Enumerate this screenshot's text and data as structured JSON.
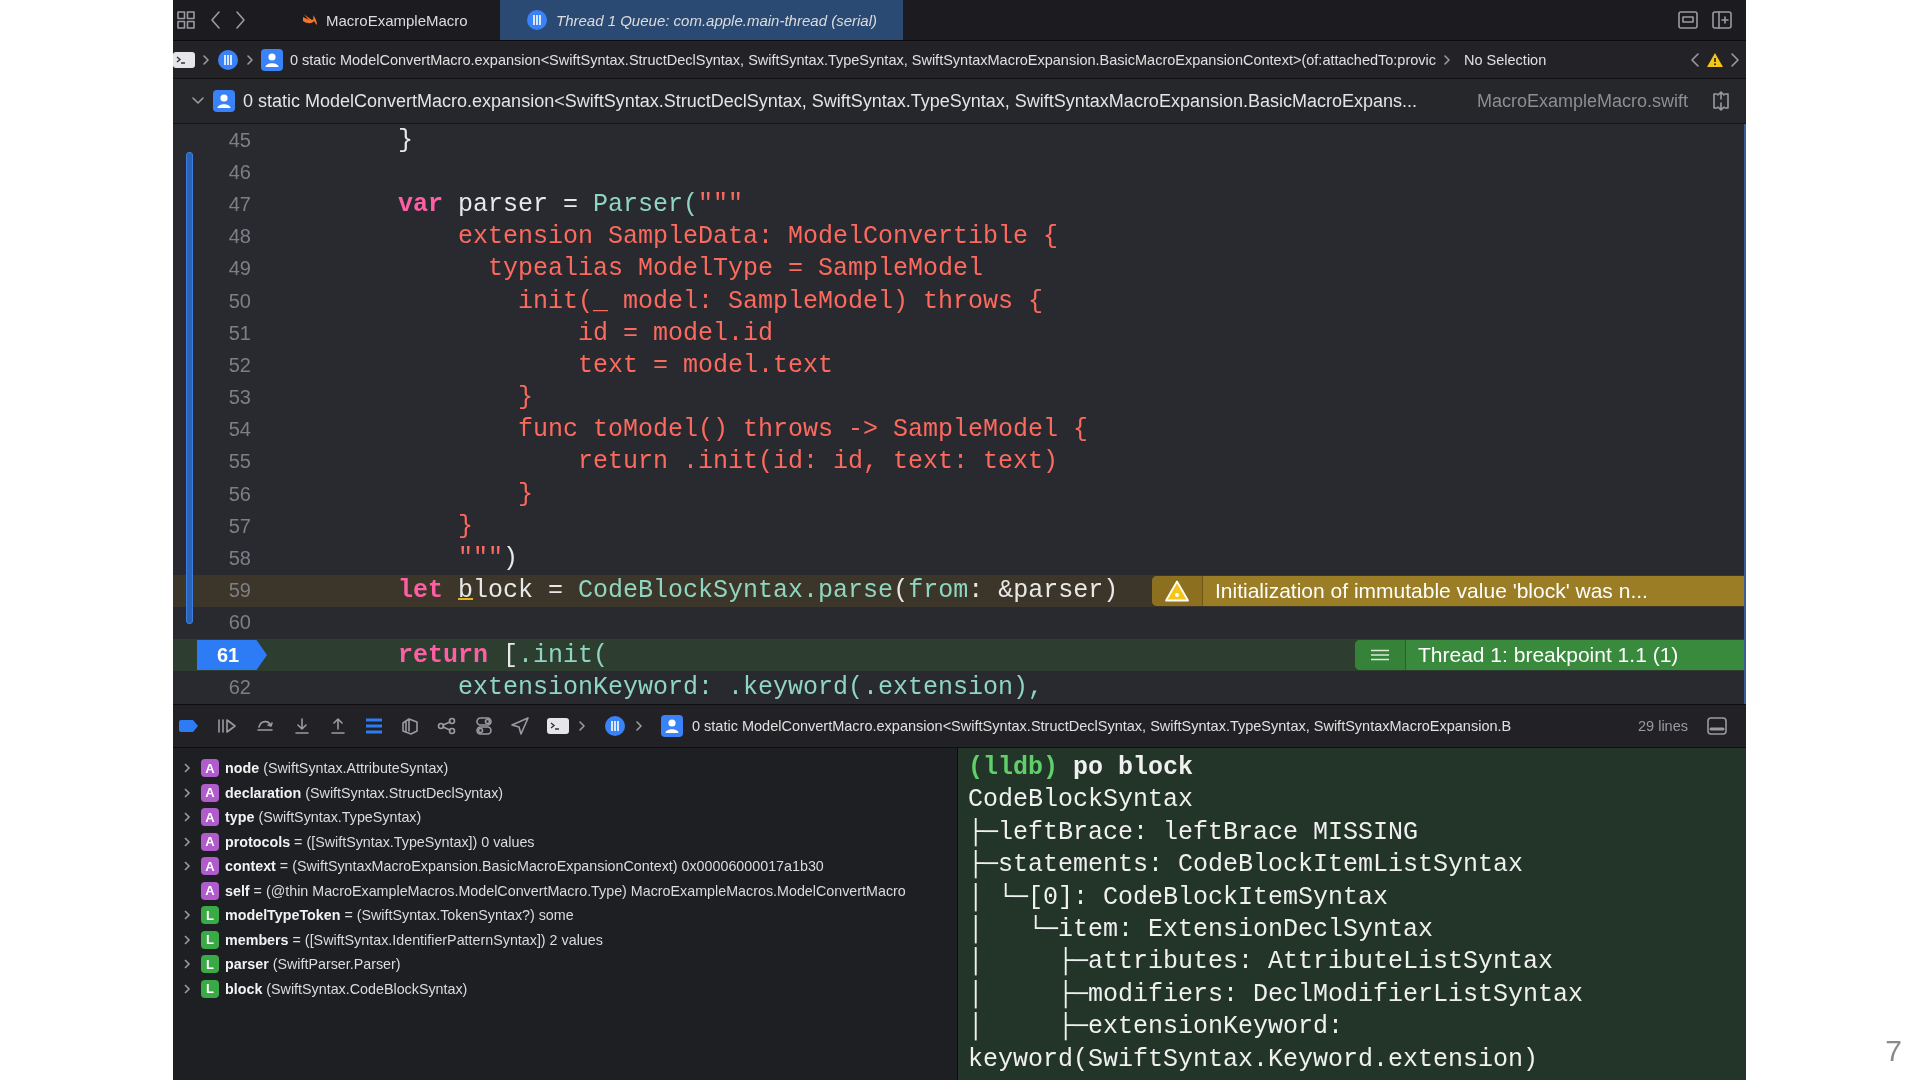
{
  "tabs": [
    {
      "label": "MacroExampleMacro",
      "selected": false
    },
    {
      "label": "Thread 1 Queue: com.apple.main-thread (serial)",
      "selected": true
    }
  ],
  "jump_bar": {
    "path": "0 static ModelConvertMacro.expansion<SwiftSyntax.StructDeclSyntax, SwiftSyntax.TypeSyntax, SwiftSyntaxMacroExpansion.BasicMacroExpansionContext>(of:attachedTo:provic",
    "selection": "No Selection"
  },
  "editor": {
    "title": "0 static ModelConvertMacro.expansion<SwiftSyntax.StructDeclSyntax, SwiftSyntax.TypeSyntax, SwiftSyntaxMacroExpansion.BasicMacroExpans...",
    "file": "MacroExampleMacro.swift",
    "lines": [
      {
        "number": "45",
        "kind": "normal",
        "breakpoint": false,
        "tokens": [
          {
            "kind": "plain",
            "text": "}"
          }
        ]
      },
      {
        "number": "46",
        "kind": "normal",
        "breakpoint": false
      },
      {
        "number": "47",
        "kind": "normal",
        "breakpoint": false,
        "tokens": [
          {
            "kind": "keyword",
            "text": "var"
          },
          {
            "kind": "plain",
            "text": " parser = "
          },
          {
            "kind": "type",
            "text": "Parser("
          },
          {
            "kind": "string",
            "text": "\"\"\""
          }
        ]
      },
      {
        "number": "48",
        "kind": "normal",
        "breakpoint": false,
        "tokens": [
          {
            "kind": "string",
            "text": "    extension SampleData: ModelConvertible {"
          }
        ]
      },
      {
        "number": "49",
        "kind": "normal",
        "breakpoint": false,
        "tokens": [
          {
            "kind": "string",
            "text": "      typealias ModelType = SampleModel"
          }
        ]
      },
      {
        "number": "50",
        "kind": "normal",
        "breakpoint": false,
        "tokens": [
          {
            "kind": "string",
            "text": "        init(_ model: SampleModel) throws {"
          }
        ]
      },
      {
        "number": "51",
        "kind": "normal",
        "breakpoint": false,
        "tokens": [
          {
            "kind": "string",
            "text": "            id = model.id"
          }
        ]
      },
      {
        "number": "52",
        "kind": "normal",
        "breakpoint": false,
        "tokens": [
          {
            "kind": "string",
            "text": "            text = model.text"
          }
        ]
      },
      {
        "number": "53",
        "kind": "normal",
        "breakpoint": false,
        "tokens": [
          {
            "kind": "string",
            "text": "        }"
          }
        ]
      },
      {
        "number": "54",
        "kind": "normal",
        "breakpoint": false,
        "tokens": [
          {
            "kind": "string",
            "text": "        func toModel() throws -> SampleModel {"
          }
        ]
      },
      {
        "number": "55",
        "kind": "normal",
        "breakpoint": false,
        "tokens": [
          {
            "kind": "string",
            "text": "            return .init(id: id, text: text)"
          }
        ]
      },
      {
        "number": "56",
        "kind": "normal",
        "breakpoint": false,
        "tokens": [
          {
            "kind": "string",
            "text": "        }"
          }
        ]
      },
      {
        "number": "57",
        "kind": "normal",
        "breakpoint": false,
        "tokens": [
          {
            "kind": "string",
            "text": "    }"
          }
        ]
      },
      {
        "number": "58",
        "kind": "normal",
        "breakpoint": false,
        "tokens": [
          {
            "kind": "string",
            "text": "    \"\"\""
          },
          {
            "kind": "plain",
            "text": ")"
          }
        ]
      },
      {
        "number": "59",
        "kind": "warning",
        "breakpoint": false,
        "tokens": [
          {
            "kind": "keyword",
            "text": "let "
          },
          {
            "kind": "flagged",
            "text": "b"
          },
          {
            "kind": "plain",
            "text": "lock = "
          },
          {
            "kind": "type",
            "text": "CodeBlockSyntax.parse"
          },
          {
            "kind": "plain",
            "text": "("
          },
          {
            "kind": "type",
            "text": "from"
          },
          {
            "kind": "plain",
            "text": ": &parser)"
          }
        ],
        "annotation": {
          "kind": "warning",
          "text": "Initialization of immutable value 'block' was n..."
        }
      },
      {
        "number": "60",
        "kind": "normal",
        "breakpoint": false
      },
      {
        "number": "61",
        "kind": "current",
        "breakpoint": true,
        "tokens": [
          {
            "kind": "keyword",
            "text": "return"
          },
          {
            "kind": "plain",
            "text": " ["
          },
          {
            "kind": "type",
            "text": ".init("
          }
        ],
        "annotation": {
          "kind": "thread",
          "text": "Thread 1: breakpoint 1.1 (1)"
        }
      },
      {
        "number": "62",
        "kind": "normal",
        "breakpoint": false,
        "tokens": [
          {
            "kind": "type",
            "text": "    extensionKeyword: .keyword(.extension),"
          }
        ]
      }
    ]
  },
  "debug_bar": {
    "path": "0 static ModelConvertMacro.expansion<SwiftSyntax.StructDeclSyntax, SwiftSyntax.TypeSyntax, SwiftSyntaxMacroExpansion.B",
    "count": "29 lines"
  },
  "variables": [
    {
      "badge": "A",
      "kind": "argument",
      "expandable": true,
      "text": "**node** (SwiftSyntax.AttributeSyntax)"
    },
    {
      "badge": "A",
      "kind": "argument",
      "expandable": true,
      "text": "**declaration** (SwiftSyntax.StructDeclSyntax)"
    },
    {
      "badge": "A",
      "kind": "argument",
      "expandable": true,
      "text": "**type** (SwiftSyntax.TypeSyntax)"
    },
    {
      "badge": "A",
      "kind": "argument",
      "expandable": true,
      "text": "**protocols** = ([SwiftSyntax.TypeSyntax]) 0 values"
    },
    {
      "badge": "A",
      "kind": "argument",
      "expandable": true,
      "text": "**context** = (SwiftSyntaxMacroExpansion.BasicMacroExpansionContext) 0x00006000017a1b30"
    },
    {
      "badge": "A",
      "kind": "argument",
      "expandable": false,
      "text": "**self** = (@thin MacroExampleMacros.ModelConvertMacro.Type) MacroExampleMacros.ModelConvertMacro"
    },
    {
      "badge": "L",
      "kind": "local",
      "expandable": true,
      "text": "**modelTypeToken** = (SwiftSyntax.TokenSyntax?) some"
    },
    {
      "badge": "L",
      "kind": "local",
      "expandable": true,
      "text": "**members** = ([SwiftSyntax.IdentifierPatternSyntax]) 2 values"
    },
    {
      "badge": "L",
      "kind": "local",
      "expandable": true,
      "text": "**parser** (SwiftParser.Parser)"
    },
    {
      "badge": "L",
      "kind": "local",
      "expandable": true,
      "text": "**block** (SwiftSyntax.CodeBlockSyntax)"
    }
  ],
  "console": {
    "prompt": "(lldb)",
    "command": "po block",
    "output": [
      "CodeBlockSyntax",
      "├─leftBrace: leftBrace MISSING",
      "├─statements: CodeBlockItemListSyntax",
      "│ └─[0]: CodeBlockItemSyntax",
      "│   └─item: ExtensionDeclSyntax",
      "│     ├─attributes: AttributeListSyntax",
      "│     ├─modifiers: DeclModifierListSyntax",
      "│     ├─extensionKeyword:",
      "keyword(SwiftSyntax.Keyword.extension)"
    ]
  },
  "page_number": "7"
}
